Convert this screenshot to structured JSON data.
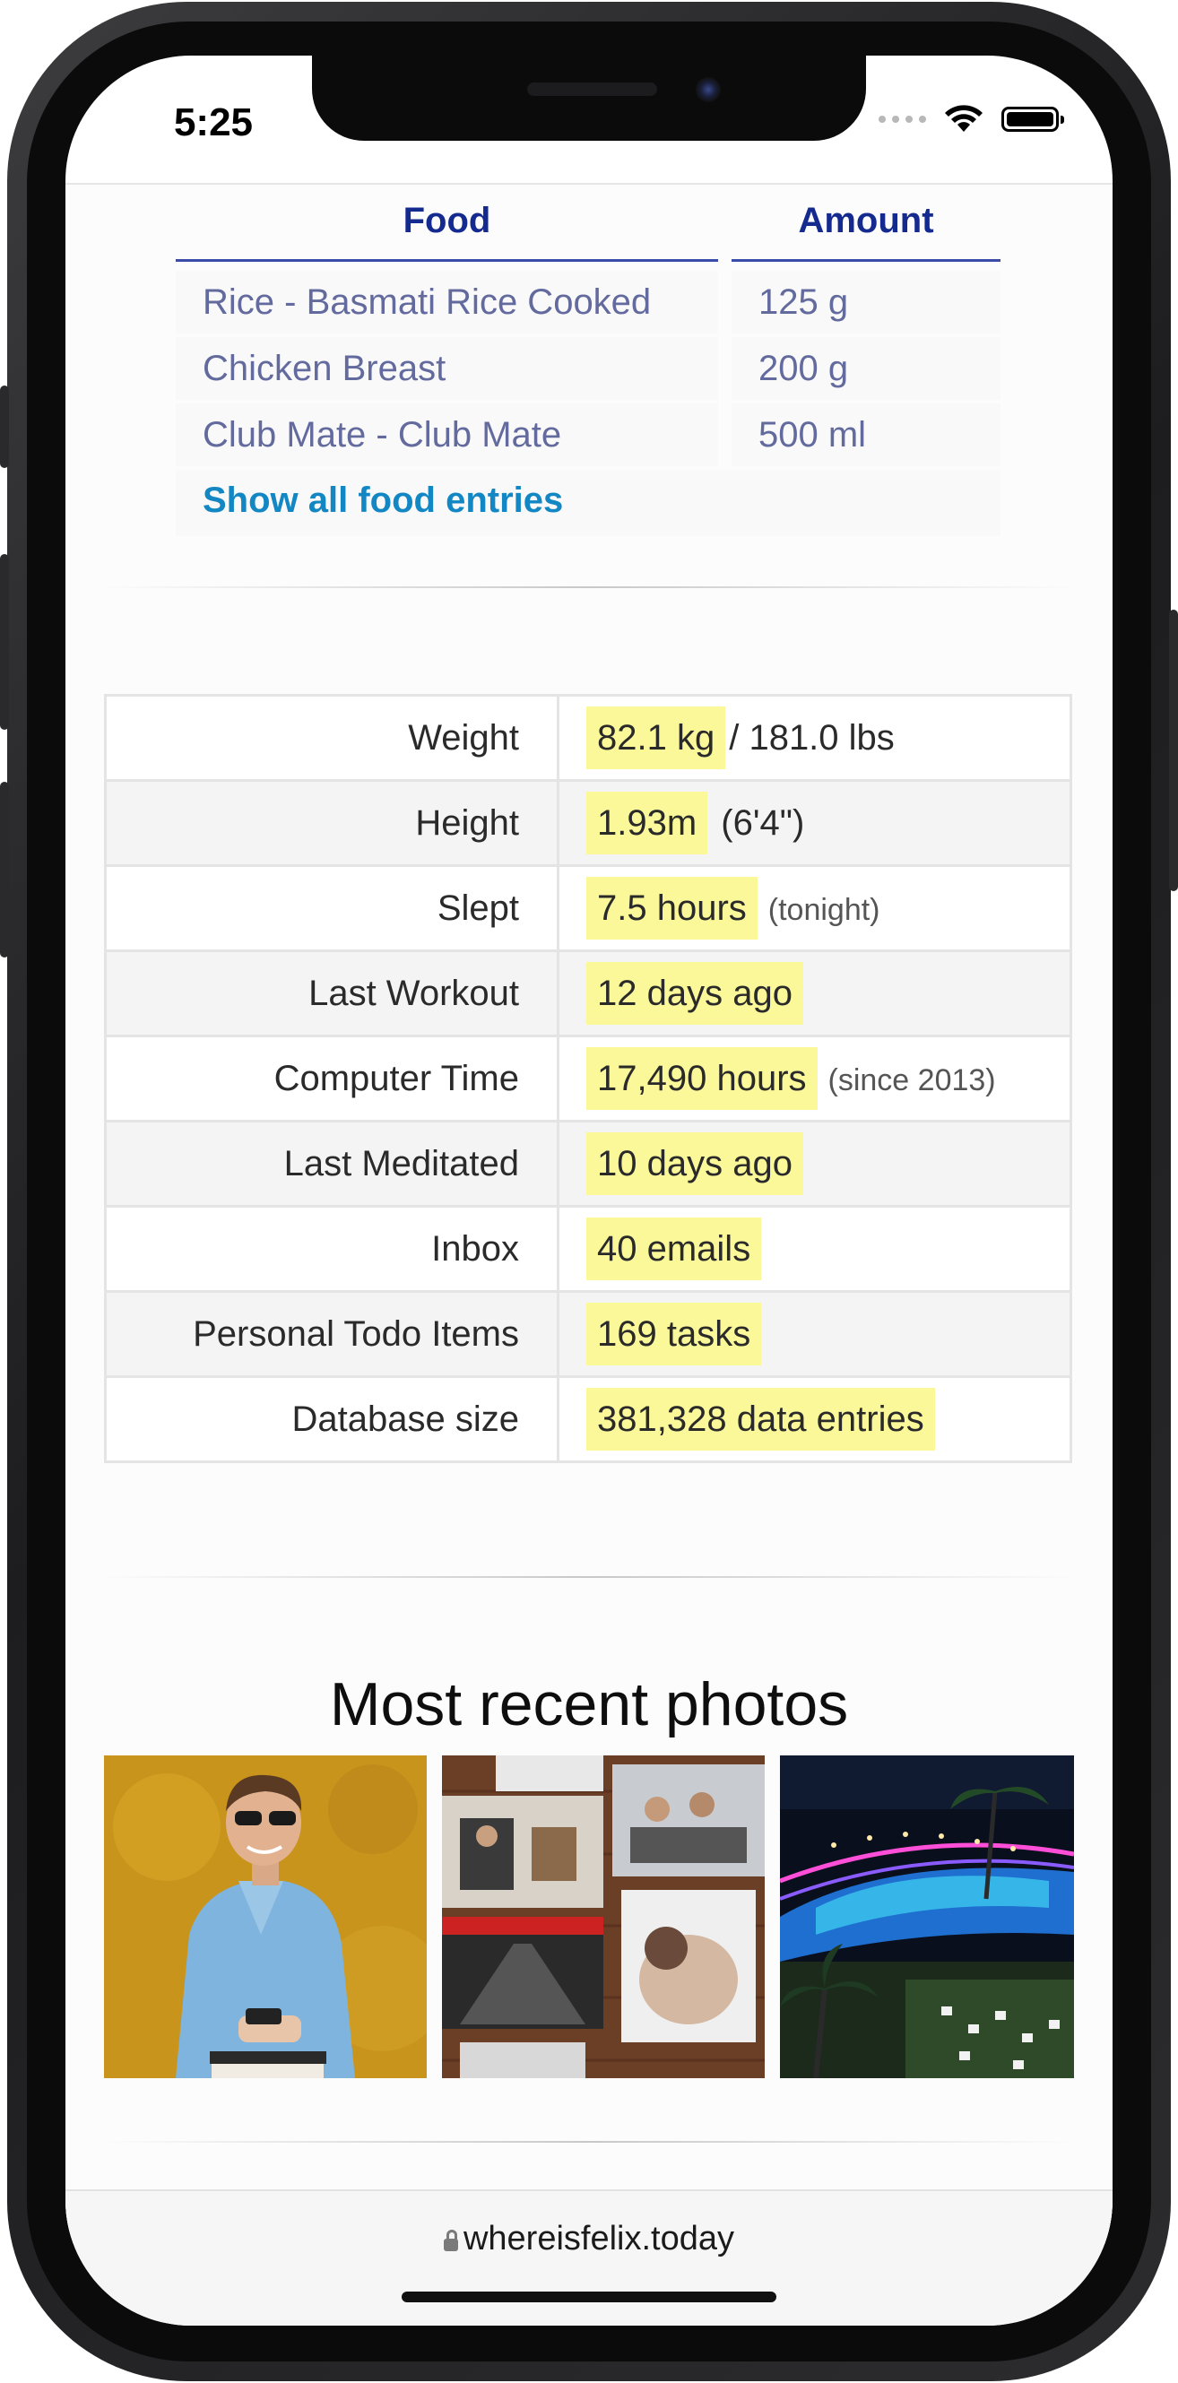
{
  "status_bar": {
    "time": "5:25"
  },
  "food_table": {
    "headers": {
      "food": "Food",
      "amount": "Amount"
    },
    "rows": [
      {
        "food": "Rice - Basmati Rice Cooked",
        "amount": "125 g"
      },
      {
        "food": "Chicken Breast",
        "amount": "200 g"
      },
      {
        "food": "Club Mate - Club Mate",
        "amount": "500 ml"
      }
    ],
    "show_all_label": "Show all food entries"
  },
  "stats": [
    {
      "label": "Weight",
      "value": "82.1 kg",
      "extra": "/ 181.0 lbs",
      "note": ""
    },
    {
      "label": "Height",
      "value": "1.93m",
      "extra": "(6'4\")",
      "note": ""
    },
    {
      "label": "Slept",
      "value": "7.5 hours",
      "extra": "",
      "note": "(tonight)"
    },
    {
      "label": "Last Workout",
      "value": "12 days ago",
      "extra": "",
      "note": ""
    },
    {
      "label": "Computer Time",
      "value": "17,490 hours",
      "extra": "",
      "note": "(since 2013)"
    },
    {
      "label": "Last Meditated",
      "value": "10 days ago",
      "extra": "",
      "note": ""
    },
    {
      "label": "Inbox",
      "value": "40 emails",
      "extra": "",
      "note": ""
    },
    {
      "label": "Personal Todo Items",
      "value": "169 tasks",
      "extra": "",
      "note": ""
    },
    {
      "label": "Database size",
      "value": "381,328 data entries",
      "extra": "",
      "note": ""
    }
  ],
  "photos": {
    "title": "Most recent photos",
    "items": [
      {
        "name": "photo-person-yellow-wall"
      },
      {
        "name": "photo-collage"
      },
      {
        "name": "photo-night-pool-resort"
      }
    ]
  },
  "browser": {
    "url": "whereisfelix.today"
  },
  "colors": {
    "highlight": "#fbf89a",
    "link": "#1287c4",
    "header": "#152a8f"
  }
}
